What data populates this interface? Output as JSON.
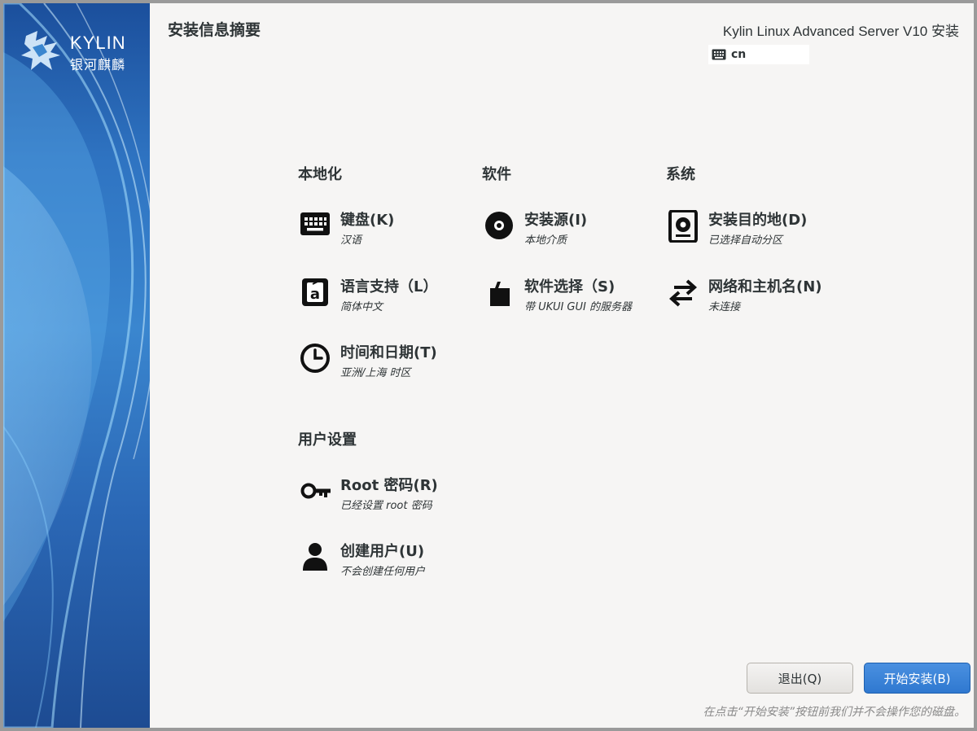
{
  "window": {
    "page_title": "安装信息摘要",
    "product_title": "Kylin Linux Advanced Server V10 安装",
    "keyboard_indicator": "cn"
  },
  "sidebar": {
    "logo_en": "KYLIN",
    "logo_cn": "银河麒麟"
  },
  "categories": {
    "localization": {
      "title": "本地化",
      "spokes": [
        {
          "title": "键盘(K)",
          "status": "汉语",
          "icon": "keyboard-icon"
        },
        {
          "title": "语言支持（L）",
          "status": "简体中文",
          "icon": "language-icon"
        },
        {
          "title": "时间和日期(T)",
          "status": "亚洲/上海 时区",
          "icon": "clock-icon"
        }
      ]
    },
    "software": {
      "title": "软件",
      "spokes": [
        {
          "title": "安装源(I)",
          "status": "本地介质",
          "icon": "disc-icon"
        },
        {
          "title": "软件选择（S)",
          "status": "带 UKUI GUI 的服务器",
          "icon": "package-icon"
        }
      ]
    },
    "system": {
      "title": "系统",
      "spokes": [
        {
          "title": "安装目的地(D)",
          "status": "已选择自动分区",
          "icon": "harddisk-icon"
        },
        {
          "title": "网络和主机名(N)",
          "status": "未连接",
          "icon": "network-arrows-icon"
        }
      ]
    },
    "user_settings": {
      "title": "用户设置",
      "spokes": [
        {
          "title": "Root 密码(R)",
          "status": "已经设置 root 密码",
          "icon": "key-icon"
        },
        {
          "title": "创建用户(U)",
          "status": "不会创建任何用户",
          "icon": "user-icon"
        }
      ]
    }
  },
  "buttons": {
    "quit": "退出(Q)",
    "begin_install": "开始安装(B)"
  },
  "warning_text": "在点击“开始安装”按钮前我们并不会操作您的磁盘。",
  "colors": {
    "accent_blue": "#3584e4",
    "sidebar_blue": "#2f74c2",
    "background": "#f6f5f4",
    "text": "#2e3436"
  }
}
